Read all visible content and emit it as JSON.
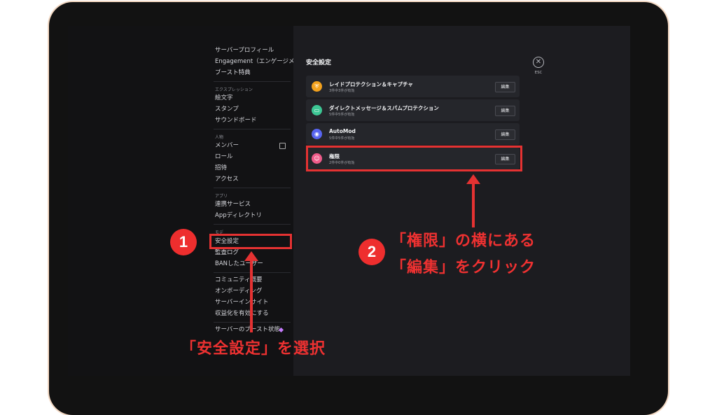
{
  "nav": {
    "items_top": [
      {
        "label": "サーバープロフィール"
      },
      {
        "label": "Engagement（エンゲージメ…"
      },
      {
        "label": "ブースト特典"
      }
    ],
    "section_expression": {
      "heading": "エクスプレッション",
      "items": [
        {
          "label": "絵文字"
        },
        {
          "label": "スタンプ"
        },
        {
          "label": "サウンドボード"
        }
      ]
    },
    "section_people": {
      "heading": "人物",
      "items": [
        {
          "label": "メンバー"
        },
        {
          "label": "ロール"
        },
        {
          "label": "招待"
        },
        {
          "label": "アクセス"
        }
      ]
    },
    "section_apps": {
      "heading": "アプリ",
      "items": [
        {
          "label": "連携サービス"
        },
        {
          "label": "Appディレクトリ"
        }
      ]
    },
    "section_moderation": {
      "heading": "モデ",
      "items": [
        {
          "label": "安全設定"
        },
        {
          "label": "監査ログ"
        },
        {
          "label": "BANしたユーザー"
        }
      ]
    },
    "section_community": {
      "items": [
        {
          "label": "コミュニティ概要"
        },
        {
          "label": "オンボーディング"
        },
        {
          "label": "サーバーインサイト"
        },
        {
          "label": "収益化を有効にする"
        }
      ]
    },
    "boost": {
      "label": "サーバーのブースト状態"
    }
  },
  "main": {
    "title": "安全設定",
    "close_label": "ESC",
    "cards": [
      {
        "title": "レイドプロテクション＆キャプチャ",
        "subtitle": "3件中3件が有効",
        "button": "編集",
        "icon": "shield-icon",
        "color": "#f4a21d"
      },
      {
        "title": "ダイレクトメッセージ＆スパムプロテクション",
        "subtitle": "5件中5件が有効",
        "button": "編集",
        "icon": "chat-icon",
        "color": "#3dc795"
      },
      {
        "title": "AutoMod",
        "subtitle": "5件中5件が有効",
        "button": "編集",
        "icon": "automod-icon",
        "color": "#5865f2"
      },
      {
        "title": "権限",
        "subtitle": "2件中0件が有効",
        "button": "編集",
        "icon": "lock-icon",
        "color": "#ef5b8a"
      }
    ]
  },
  "annotations": {
    "step1_number": "1",
    "step1_text": "「安全設定」を選択",
    "step2_number": "2",
    "step2_line1": "「権限」の横にある",
    "step2_line2": "「編集」をクリック",
    "accent": "#e53232"
  }
}
